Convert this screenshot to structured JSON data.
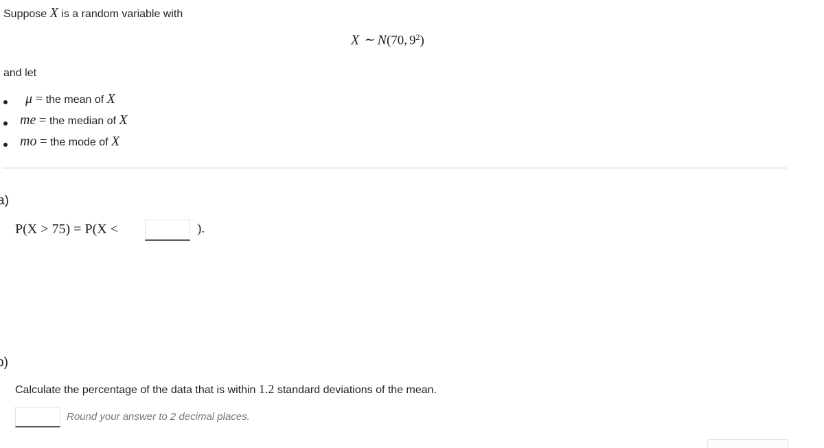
{
  "intro": {
    "text_before": "Suppose",
    "var": "X",
    "text_after": "is a random variable with"
  },
  "distribution": {
    "var": "X",
    "sim": "∼",
    "dist": "N",
    "open": "(",
    "mean": "70",
    "comma": ",",
    "sd_base": "9",
    "sd_exp": "2",
    "close": ")"
  },
  "and_let": "and let",
  "definitions": [
    {
      "symbol": "μ",
      "eq": "=",
      "text": "the mean of",
      "var": "X"
    },
    {
      "symbol": "me",
      "eq": "=",
      "text": "the median of",
      "var": "X"
    },
    {
      "symbol": "mo",
      "eq": "=",
      "text": "the mode of",
      "var": "X"
    }
  ],
  "part_a": {
    "label": "a)",
    "lhs": "P(X > 75) = P(X <",
    "rhs": ").",
    "answer_value": ""
  },
  "part_b": {
    "label": "b)",
    "question_before": "Calculate the percentage of the data that is within",
    "question_num": "1.2",
    "question_after": "standard deviations of the mean.",
    "answer_value": "",
    "hint": "Round your answer to 2 decimal places."
  }
}
